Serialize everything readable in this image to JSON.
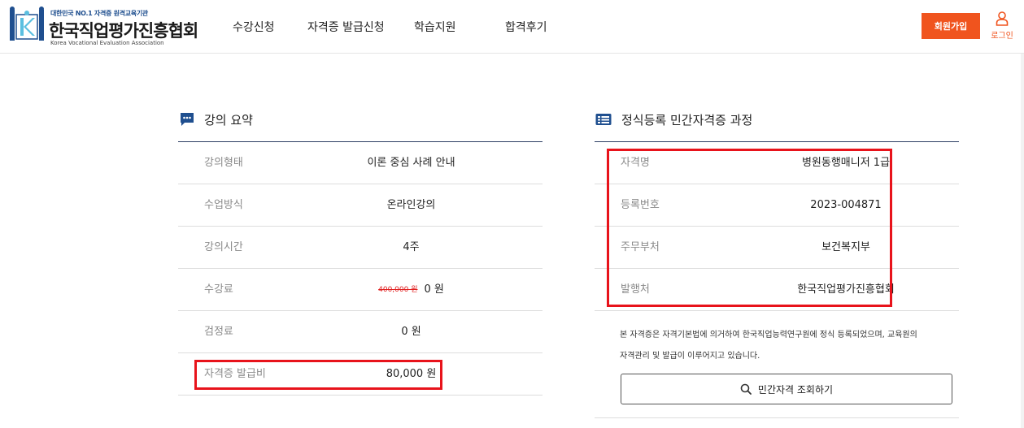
{
  "header": {
    "logo": {
      "tagline": "대한민국 NO.1 자격증 원격교육기관",
      "name": "한국직업평가진흥협회",
      "english": "Korea Vocational Evaluation Association"
    },
    "nav": [
      "수강신청",
      "자격증 발급신청",
      "학습지원",
      "합격후기"
    ],
    "signup_label": "회원가입",
    "login_label": "로그인"
  },
  "course_summary": {
    "title": "강의 요약",
    "rows": [
      {
        "label": "강의형태",
        "value": "이론 중심 사례 안내"
      },
      {
        "label": "수업방식",
        "value": "온라인강의"
      },
      {
        "label": "강의시간",
        "value": "4주"
      },
      {
        "label": "수강료",
        "original": "400,000 원",
        "value": "0 원"
      },
      {
        "label": "검정료",
        "value": "0 원"
      },
      {
        "label": "자격증 발급비",
        "value": "80,000 원"
      }
    ]
  },
  "certification": {
    "title": "정식등록 민간자격증 과정",
    "rows": [
      {
        "label": "자격명",
        "value": "병원동행매니저 1급"
      },
      {
        "label": "등록번호",
        "value": "2023-004871"
      },
      {
        "label": "주무부처",
        "value": "보건복지부"
      },
      {
        "label": "발행처",
        "value": "한국직업평가진흥협회"
      }
    ],
    "notice_line1": "본 자격증은 자격기본법에 의거하여 한국직업능력연구원에 정식 등록되었으며, 교육원의",
    "notice_line2": "자격관리 및 발급이 이루어지고 있습니다.",
    "verify_button": "민간자격 조회하기"
  },
  "colors": {
    "accent": "#f0541e",
    "highlight": "#e8131b",
    "navy": "#1f4f8f"
  },
  "icons": {
    "left_section": "chat-bubble-icon",
    "right_section": "list-card-icon",
    "login": "person-icon",
    "verify": "search-icon"
  }
}
